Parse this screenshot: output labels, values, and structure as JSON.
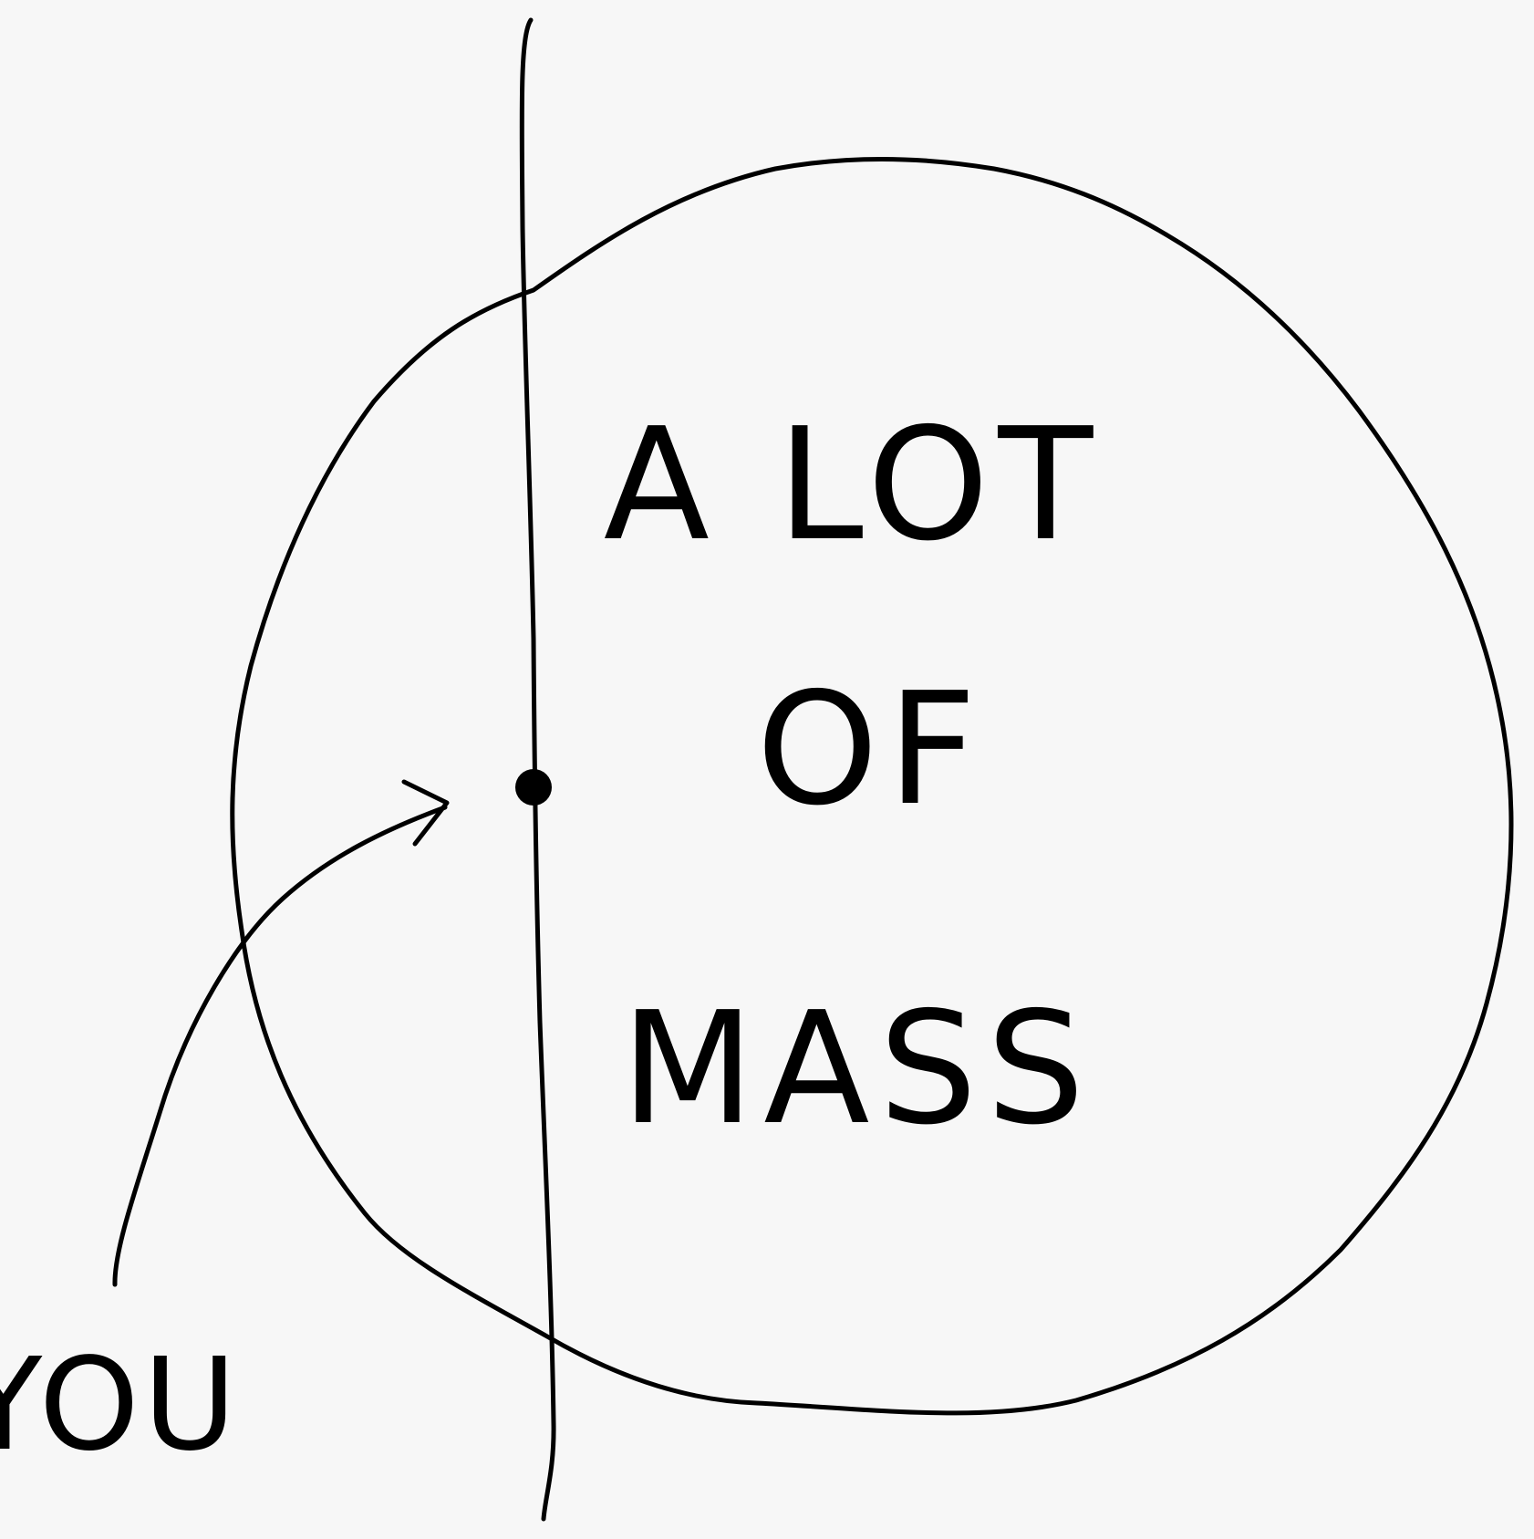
{
  "labels": {
    "mass_line1": "A LOT",
    "mass_line2": "OF",
    "mass_line3": "MASS",
    "observer": "YOU"
  },
  "colors": {
    "background": "#f7f7f7",
    "ink": "#000000"
  }
}
